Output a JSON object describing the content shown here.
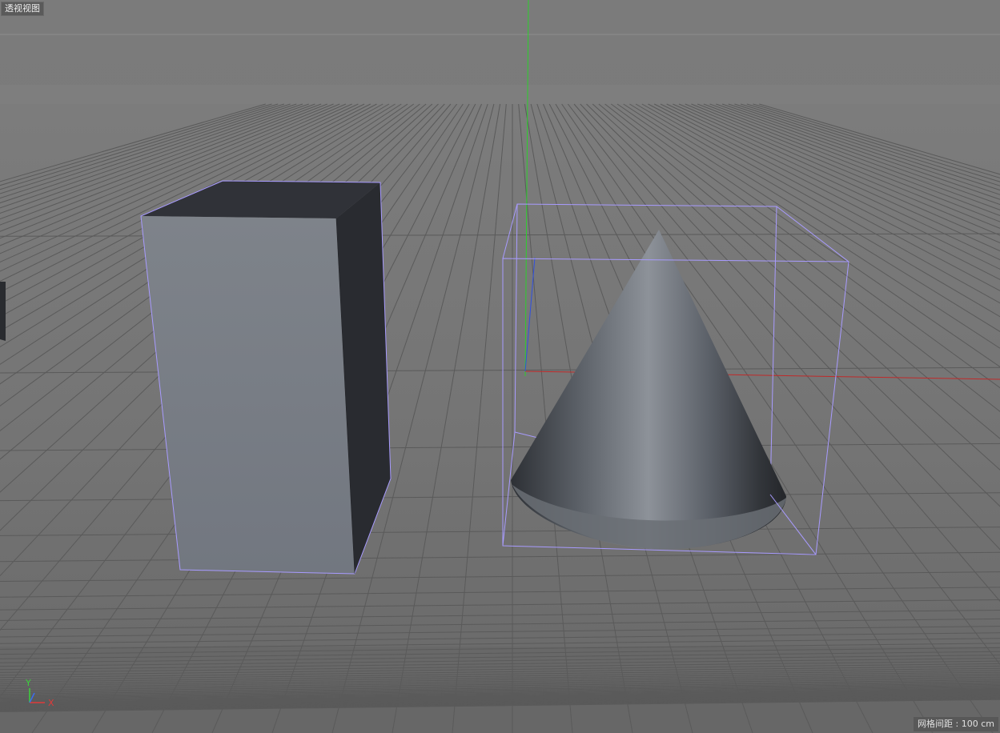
{
  "viewport": {
    "view_label": "透视视图",
    "grid_spacing": "网格间距 : 100 cm"
  },
  "axis_widget": {
    "y_label": "Y",
    "x_label": "X",
    "y_color": "#3bd13b",
    "x_color": "#e03a3a",
    "z_color": "#3a6ef0"
  },
  "colors": {
    "background": "#7a7a7a",
    "grid_line": "#595959",
    "selection": "#a89bff",
    "world_y_axis": "#2ccf2c",
    "world_x_axis": "#c02a2a",
    "world_z_axis": "#3050e0"
  },
  "objects": [
    {
      "name": "cube",
      "selected": false
    },
    {
      "name": "cone",
      "selected": true
    }
  ]
}
